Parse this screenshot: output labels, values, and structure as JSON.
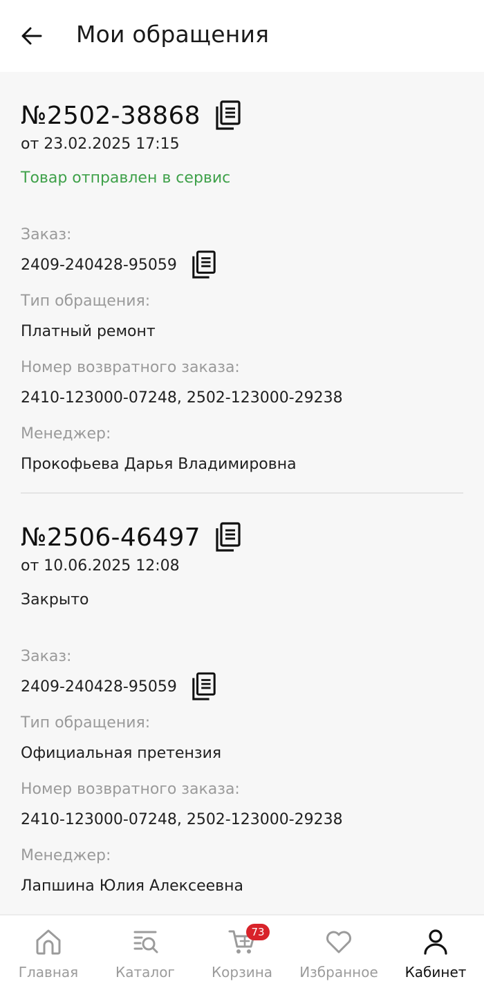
{
  "header": {
    "title": "Мои обращения",
    "back_icon": "arrow-left-icon"
  },
  "requests": [
    {
      "number": "№2502-38868",
      "date": "от 23.02.2025 17:15",
      "status": "Товар отправлен в сервис",
      "status_color": "#3fa14a",
      "order_label": "Заказ:",
      "order_value": "2409-240428-95059",
      "type_label": "Тип обращения:",
      "type_value": "Платный ремонт",
      "return_label": "Номер возвратного заказа:",
      "return_value": "2410-123000-07248, 2502-123000-29238",
      "manager_label": "Менеджер:",
      "manager_value": "Прокофьева Дарья Владимировна"
    },
    {
      "number": "№2506-46497",
      "date": "от 10.06.2025 12:08",
      "status": "Закрыто",
      "status_color": "#222222",
      "order_label": "Заказ:",
      "order_value": "2409-240428-95059",
      "type_label": "Тип обращения:",
      "type_value": "Официальная претензия",
      "return_label": "Номер возвратного заказа:",
      "return_value": "2410-123000-07248, 2502-123000-29238",
      "manager_label": "Менеджер:",
      "manager_value": "Лапшина Юлия Алексеевна"
    }
  ],
  "bottom_nav": {
    "items": [
      {
        "label": "Главная",
        "icon": "home-icon"
      },
      {
        "label": "Каталог",
        "icon": "catalog-search-icon"
      },
      {
        "label": "Корзина",
        "icon": "cart-icon",
        "badge": "73"
      },
      {
        "label": "Избранное",
        "icon": "heart-icon"
      },
      {
        "label": "Кабинет",
        "icon": "user-icon",
        "active": true
      }
    ],
    "badge_color": "#d8232a"
  }
}
